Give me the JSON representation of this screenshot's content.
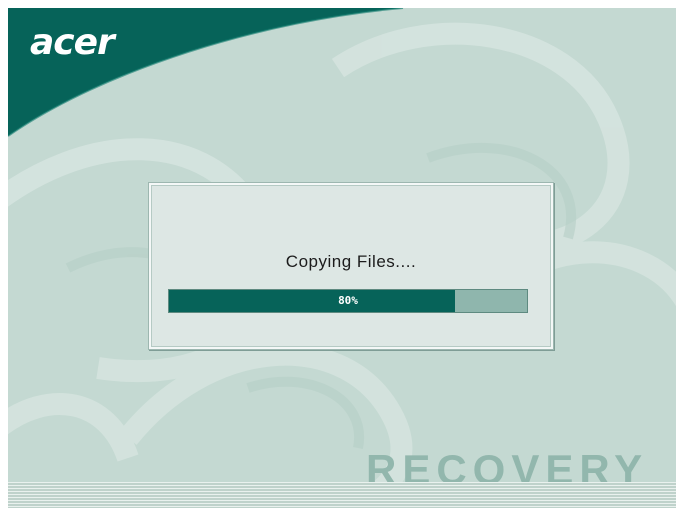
{
  "logo": {
    "text": "acer"
  },
  "dialog": {
    "title": "Copying Files....",
    "progress": {
      "value": 80,
      "label": "80%"
    }
  },
  "watermark": {
    "text": "RECOVERY"
  },
  "colors": {
    "brand": "#066359",
    "background": "#c4d9d2",
    "progress_track": "#8fb6ad",
    "watermark": "#92b7ad"
  }
}
